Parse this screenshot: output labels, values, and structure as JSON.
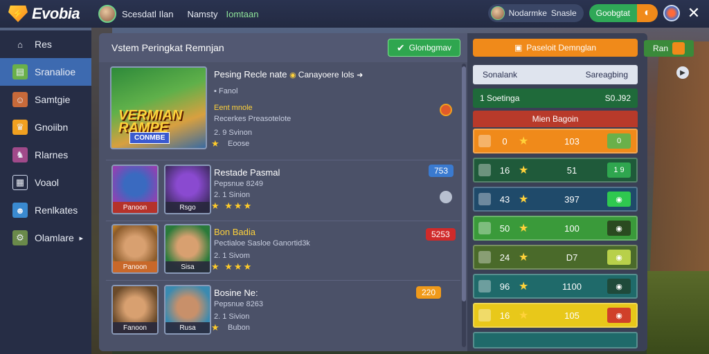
{
  "app": {
    "logo_text": "Evobia"
  },
  "topbar": {
    "user_name": "Scesdatl Ilan",
    "nickname": "Namsty",
    "status": "Iomtaan",
    "rank_label": "Nodarmke",
    "rank_value": "Snasle",
    "coin_label": "Goobgtat"
  },
  "sidebar": {
    "items": [
      {
        "label": "Res",
        "icon": "home-icon"
      },
      {
        "label": "Sranalioe",
        "icon": "chart-icon"
      },
      {
        "label": "Samtgie",
        "icon": "avatar-icon"
      },
      {
        "label": "Gnoiibn",
        "icon": "trophy-icon"
      },
      {
        "label": "Rlarnes",
        "icon": "hero-icon"
      },
      {
        "label": "Voaol",
        "icon": "calendar-icon"
      },
      {
        "label": "Renlkates",
        "icon": "shop-icon"
      },
      {
        "label": "Olamlare",
        "icon": "settings-icon"
      }
    ]
  },
  "panel": {
    "title": "Vstem Peringkat Remnjan",
    "action_label": "Glonbgmav"
  },
  "rows": [
    {
      "title": "Pesing Recle nate",
      "subtitle_tail": "Canayoere Iols",
      "line2": "Fanol",
      "yellow": "Eent mnole",
      "line4": "Recerkes Preasotelote",
      "line5": "2. 9 Svinon",
      "line6": "Eoose",
      "thumb_title": "VERMIAN RAMPE",
      "thumb_tag": "CONMBE"
    },
    {
      "title": "Restade Pasmal",
      "line2": "Pepsnue 8249",
      "line3": "2. 1 Sinion",
      "badge": "753",
      "thumb1_label": "Panoon",
      "thumb2_label": "Rsgo"
    },
    {
      "title": "Bon Badia",
      "line2": "Pectialoe Sasloe Ganortid3k",
      "line3": "2. 1 Sivom",
      "badge": "5253",
      "thumb1_label": "Panoon",
      "thumb2_label": "Sisa"
    },
    {
      "title": "Bosine Ne:",
      "line2": "Pepsnue 8263",
      "line3": "2. 1 Sivion",
      "line4": "Bubon",
      "badge": "220",
      "thumb1_label": "Fanoon",
      "thumb2_label": "Rusa"
    }
  ],
  "leaderboard": {
    "top_button": "Paseloit Demnglan",
    "search_left": "Sonalank",
    "search_right": "Sareagbing",
    "green_left": "1 Soetinga",
    "green_right": "S0.J92",
    "header": "Mien Bagoin",
    "rows": [
      {
        "n": "0",
        "score": "103",
        "act": "0",
        "color": "#f08a1a",
        "act_color": "#6ab04a"
      },
      {
        "n": "16",
        "score": "51",
        "act": "1 9",
        "color": "#1f5a3a",
        "act_color": "#2fa64f"
      },
      {
        "n": "43",
        "score": "397",
        "act": "",
        "color": "#1f4a6a",
        "act_color": "#2fc84f"
      },
      {
        "n": "50",
        "score": "100",
        "act": "",
        "color": "#3a9a3a",
        "act_color": "#2a4a20"
      },
      {
        "n": "24",
        "score": "D7",
        "act": "",
        "color": "#4a6a2a",
        "act_color": "#b8d04a"
      },
      {
        "n": "96",
        "score": "1100",
        "act": "",
        "color": "#1f6a6a",
        "act_color": "#1f4a3a"
      },
      {
        "n": "16",
        "score": "105",
        "act": "",
        "color": "#e8c81a",
        "act_color": "#d0402a"
      }
    ]
  },
  "mini": {
    "label": "Ran"
  }
}
